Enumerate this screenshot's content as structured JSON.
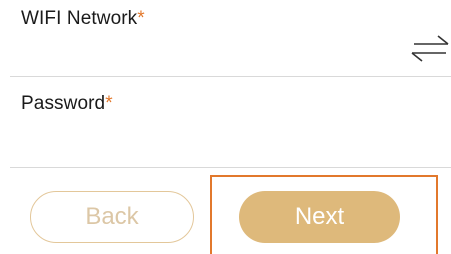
{
  "wifi_field": {
    "label": "WIFI Network",
    "required_marker": "*",
    "value": "",
    "swap_icon": "swap-arrows-icon"
  },
  "password_field": {
    "label": "Password",
    "required_marker": "*",
    "value": ""
  },
  "buttons": {
    "back_label": "Back",
    "next_label": "Next"
  },
  "colors": {
    "required_star": "#e2782c",
    "back_border": "#e3c79a",
    "back_text": "#dcc7a6",
    "next_fill": "#deb97b",
    "highlight": "#e2782c"
  }
}
